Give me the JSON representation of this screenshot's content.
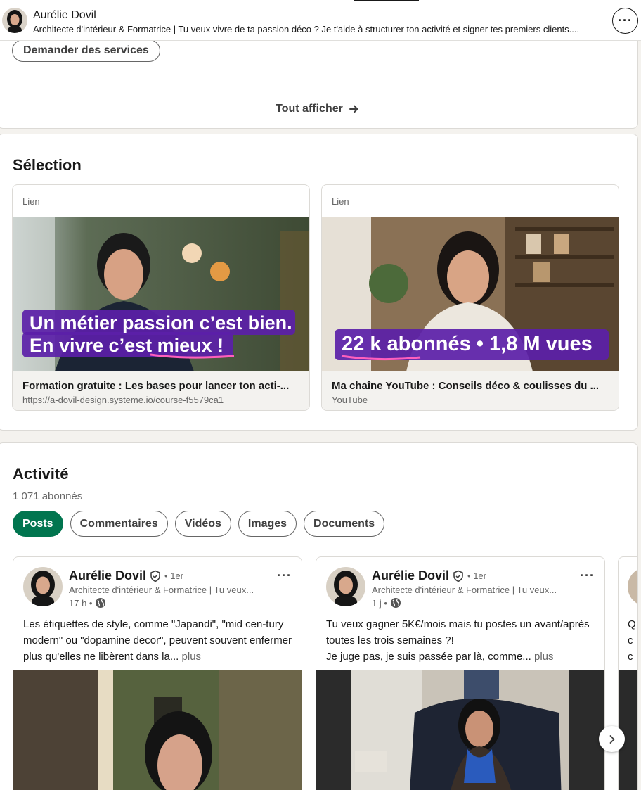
{
  "sticky_header": {
    "name": "Aurélie Dovil",
    "headline": "Architecte d'intérieur & Formatrice | Tu veux vivre de ta passion déco ? Je t'aide à structurer ton activité et signer tes premiers clients....",
    "more_label": "···"
  },
  "services": {
    "request_button": "Demander des services",
    "show_all": "Tout afficher",
    "show_all_icon": "arrow-right-icon"
  },
  "selection": {
    "title": "Sélection",
    "items": [
      {
        "kind": "Lien",
        "overlay_line1": "Un métier passion c’est bien.",
        "overlay_line2": "En vivre c’est mieux !",
        "title": "Formation gratuite : Les bases pour lancer ton acti-...",
        "subtitle": "https://a-dovil-design.systeme.io/course-f5579ca1"
      },
      {
        "kind": "Lien",
        "overlay_line1": "22 k abonnés • 1,8 M vues",
        "title": "Ma chaîne YouTube : Conseils déco & coulisses du ...",
        "subtitle": "YouTube"
      }
    ]
  },
  "activity": {
    "title": "Activité",
    "followers": "1 071 abonnés",
    "filters": [
      "Posts",
      "Commentaires",
      "Vidéos",
      "Images",
      "Documents"
    ],
    "active_filter": "Posts",
    "accent_color": "#01754f",
    "posts": [
      {
        "author": "Aurélie Dovil",
        "degree": "• 1er",
        "headline": "Architecte d'intérieur & Formatrice | Tu veux...",
        "time": "17 h •",
        "text": "Les étiquettes de style, comme \"Japandi\", \"mid cen-tury modern\" ou \"dopamine decor\", peuvent souvent enfermer plus qu'elles ne libèrent dans la...",
        "more": "plus"
      },
      {
        "author": "Aurélie Dovil",
        "degree": "• 1er",
        "headline": "Architecte d'intérieur & Formatrice | Tu veux...",
        "time": "1 j •",
        "text_line1": "Tu veux gagner 5K€/mois mais tu postes un avant/après toutes les trois semaines ?!",
        "text_line2": "Je juge pas, je suis passée par là, comme...",
        "more": "plus"
      }
    ],
    "peek_text": [
      "Q",
      "c",
      "c"
    ],
    "next_icon": "chevron-right-icon"
  }
}
